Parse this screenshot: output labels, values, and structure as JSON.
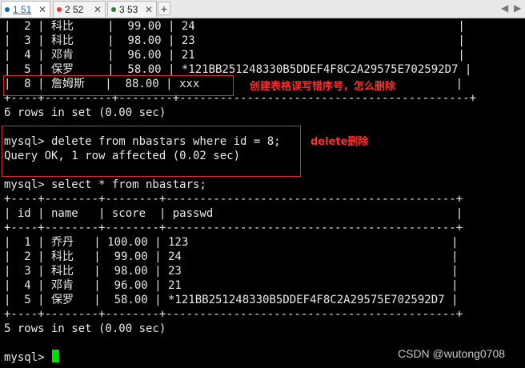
{
  "tabs": [
    {
      "label": "1 51",
      "dot_color": "#1565c0",
      "active": true
    },
    {
      "label": "2 52",
      "dot_color": "#e53935",
      "active": false
    },
    {
      "label": "3 53",
      "dot_color": "#2e7d32",
      "active": false
    }
  ],
  "tab_close_icon": "close-icon",
  "new_tab_label": "+",
  "nav": {
    "left": "◀",
    "right": "▶"
  },
  "terminal": {
    "lines": [
      "|  2 | 科比     |  99.00 | 24                                       |",
      "|  3 | 科比     |  98.00 | 23                                       |",
      "|  4 | 邓肯     |  96.00 | 21                                       |",
      "|  5 | 保罗     |  58.00 | *121BB251248330B5DDEF4F8C2A29575E702592D7 |",
      "|  8 | 詹姆斯   |  88.00 | xxx                                      |",
      "+----+----------+--------+-------------------------------------------+",
      "6 rows in set (0.00 sec)",
      "",
      "mysql> delete from nbastars where id = 8;",
      "Query OK, 1 row affected (0.02 sec)",
      "",
      "mysql> select * from nbastars;",
      "+----+--------+--------+-------------------------------------------+",
      "| id | name   | score  | passwd                                    |",
      "+----+--------+--------+-------------------------------------------+",
      "|  1 | 乔丹   | 100.00 | 123                                       |",
      "|  2 | 科比   |  99.00 | 24                                        |",
      "|  3 | 科比   |  98.00 | 23                                        |",
      "|  4 | 邓肯   |  96.00 | 21                                        |",
      "|  5 | 保罗   |  58.00 | *121BB251248330B5DDEF4F8C2A29575E702592D7 |",
      "+----+--------+--------+-------------------------------------------+",
      "5 rows in set (0.00 sec)",
      "",
      "mysql> "
    ]
  },
  "annotations": {
    "wrong_row_note": "创建表格误写错序号，怎么删除",
    "delete_note": "delete删除",
    "color": "#ff3030"
  },
  "watermark": "CSDN @wutong0708"
}
